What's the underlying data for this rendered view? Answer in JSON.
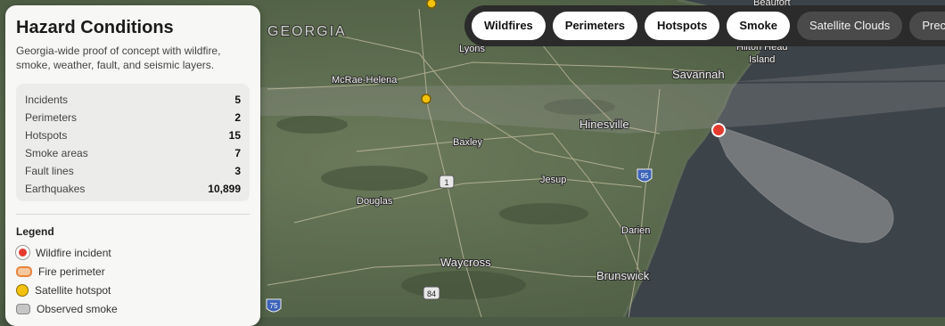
{
  "panel": {
    "title": "Hazard Conditions",
    "subtitle": "Georgia-wide proof of concept with wildfire, smoke, weather, fault, and seismic layers.",
    "stats": [
      {
        "label": "Incidents",
        "value": "5"
      },
      {
        "label": "Perimeters",
        "value": "2"
      },
      {
        "label": "Hotspots",
        "value": "15"
      },
      {
        "label": "Smoke areas",
        "value": "7"
      },
      {
        "label": "Fault lines",
        "value": "3"
      },
      {
        "label": "Earthquakes",
        "value": "10,899"
      }
    ],
    "legend_title": "Legend",
    "legend": [
      {
        "label": "Wildfire incident",
        "icon": "incident-marker-icon"
      },
      {
        "label": "Fire perimeter",
        "icon": "perimeter-swatch-icon"
      },
      {
        "label": "Satellite hotspot",
        "icon": "hotspot-marker-icon"
      },
      {
        "label": "Observed smoke",
        "icon": "smoke-swatch-icon"
      }
    ]
  },
  "layers": {
    "wildfires": "Wildfires",
    "perimeters": "Perimeters",
    "hotspots": "Hotspots",
    "smoke": "Smoke",
    "satellite_clouds": "Satellite Clouds",
    "precip": "Prec"
  },
  "map_labels": {
    "state": "GEORGIA",
    "mcrae": "McRae-Helena",
    "lyons": "Lyons",
    "baxley": "Baxley",
    "hinesville": "Hinesville",
    "savannah": "Savannah",
    "hilton_head": "Hilton Head",
    "island": "Island",
    "beaufort": "Beaufort",
    "douglas": "Douglas",
    "jesup": "Jesup",
    "darien": "Darien",
    "waycross": "Waycross",
    "brunswick": "Brunswick",
    "shield_1": "1",
    "shield_95a": "95",
    "shield_84": "84",
    "shield_75": "75"
  },
  "colors": {
    "incident": "#e53b2e",
    "hotspot": "#f4c20d",
    "perimeter": "#e8853c",
    "smoke": "#c6c6c6"
  }
}
